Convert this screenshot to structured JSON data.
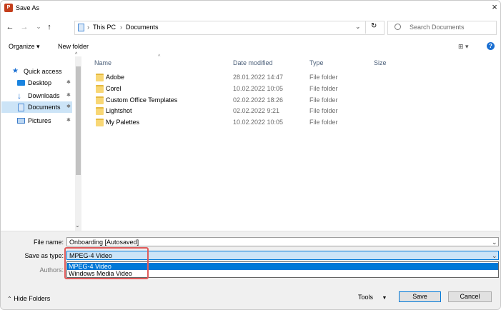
{
  "window": {
    "title": "Save As",
    "app_icon": "P",
    "close_glyph": "×"
  },
  "nav": {
    "back": "←",
    "forward": "→",
    "recent": "⌄",
    "up": "↑",
    "breadcrumb": [
      "This PC",
      "Documents"
    ],
    "breadcrumb_sep": "›",
    "refresh": "↻",
    "search_placeholder": "Search Documents"
  },
  "toolbar": {
    "organize": "Organize ▾",
    "new_folder": "New folder",
    "view": "⊞ ▾",
    "help": "?"
  },
  "sidebar": {
    "items": [
      {
        "label": "Quick access",
        "icon": "star-icon"
      },
      {
        "label": "Desktop",
        "icon": "desktop-icon"
      },
      {
        "label": "Downloads",
        "icon": "download-icon"
      },
      {
        "label": "Documents",
        "icon": "documents-icon",
        "selected": true
      },
      {
        "label": "Pictures",
        "icon": "pictures-icon"
      }
    ],
    "pin_glyph": "✱"
  },
  "columns": {
    "name": "Name",
    "date": "Date modified",
    "type": "Type",
    "size": "Size"
  },
  "files": [
    {
      "name": "Adobe",
      "date": "28.01.2022 14:47",
      "type": "File folder"
    },
    {
      "name": "Corel",
      "date": "10.02.2022 10:05",
      "type": "File folder"
    },
    {
      "name": "Custom Office Templates",
      "date": "02.02.2022 18:26",
      "type": "File folder"
    },
    {
      "name": "Lightshot",
      "date": "02.02.2022 9:21",
      "type": "File folder"
    },
    {
      "name": "My Palettes",
      "date": "10.02.2022 10:05",
      "type": "File folder"
    }
  ],
  "form": {
    "file_name_label": "File name:",
    "file_name_value": "Onboarding [Autosaved]",
    "save_type_label": "Save as type:",
    "save_type_value": "MPEG-4 Video",
    "authors_label": "Authors:",
    "type_options": [
      "MPEG-4 Video",
      "Windows Media Video"
    ]
  },
  "footer": {
    "hide_folders": "Hide Folders",
    "tools": "Tools",
    "save": "Save",
    "cancel": "Cancel"
  },
  "colors": {
    "accent": "#0078d7",
    "highlight": "#e05a5a",
    "folder": "#f8d775"
  }
}
